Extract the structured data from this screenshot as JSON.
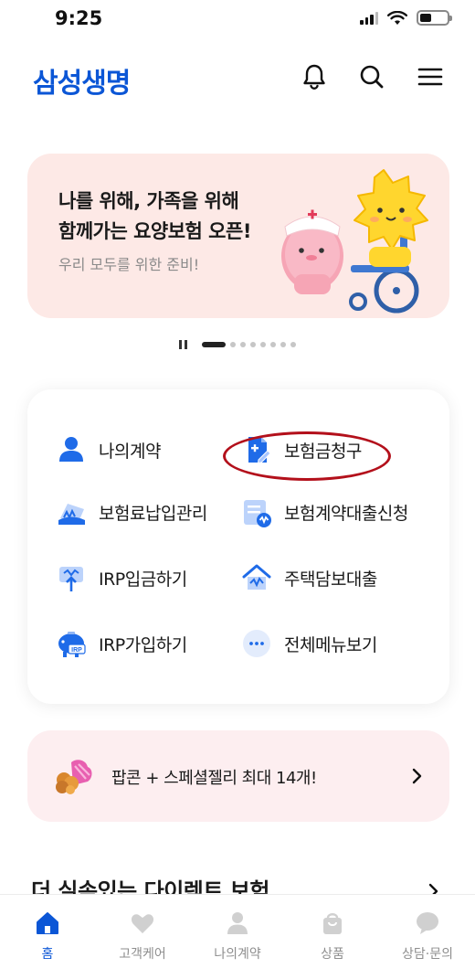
{
  "status": {
    "time": "9:25"
  },
  "header": {
    "logo": "삼성생명",
    "icons": [
      "bell-icon",
      "search-icon",
      "menu-icon"
    ]
  },
  "banner": {
    "title": "나를 위해, 가족을 위해\n함께가는 요양보험 오픈!",
    "subtitle": "우리 모두를 위한 준비!",
    "art": "mascot-illustration",
    "bg_color": "#fde9e6"
  },
  "pager": {
    "count": 8,
    "active_index": 0
  },
  "quick_menu": {
    "items": [
      {
        "label": "나의계약",
        "icon": "person-icon"
      },
      {
        "label": "보험금청구",
        "icon": "claim-document-icon",
        "highlighted": true
      },
      {
        "label": "보험료납입관리",
        "icon": "premium-payment-icon"
      },
      {
        "label": "보험계약대출신청",
        "icon": "contract-loan-icon"
      },
      {
        "label": "IRP입금하기",
        "icon": "irp-deposit-icon"
      },
      {
        "label": "주택담보대출",
        "icon": "home-loan-icon"
      },
      {
        "label": "IRP가입하기",
        "icon": "irp-piggy-icon"
      },
      {
        "label": "전체메뉴보기",
        "icon": "more-dots-icon"
      }
    ]
  },
  "promo": {
    "text": "팝콘 + 스페셜젤리 최대 14개!",
    "bg_color": "#fdeef0"
  },
  "section": {
    "title": "더 실속있는 다이렉트 보험"
  },
  "tabbar": {
    "tabs": [
      {
        "label": "홈",
        "icon": "home-icon",
        "active": true
      },
      {
        "label": "고객케어",
        "icon": "heart-icon"
      },
      {
        "label": "나의계약",
        "icon": "person-icon"
      },
      {
        "label": "상품",
        "icon": "shopping-bag-icon"
      },
      {
        "label": "상담·문의",
        "icon": "chat-bubble-icon"
      }
    ]
  },
  "colors": {
    "brand": "#0b56d6",
    "highlight_ring": "#b3101b"
  }
}
